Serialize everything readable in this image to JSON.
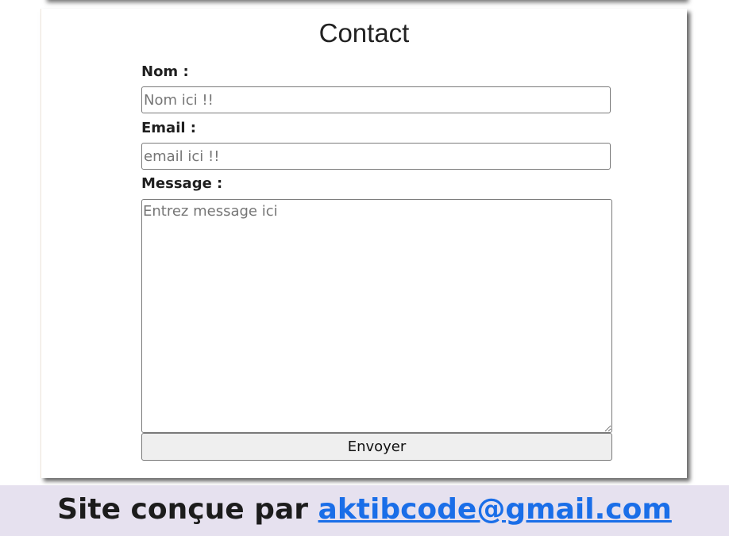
{
  "contact": {
    "title": "Contact",
    "name_label": "Nom :",
    "name_placeholder": "Nom ici !!",
    "email_label": "Email :",
    "email_placeholder": "email ici !!",
    "message_label": "Message :",
    "message_placeholder": "Entrez message ici",
    "submit_label": "Envoyer"
  },
  "footer": {
    "text": "Site conçue par",
    "email_link": "aktibcode@gmail.com"
  },
  "colors": {
    "footer_background": "#e6e1ef",
    "link": "#1a6ee8",
    "button_background": "#efefef"
  }
}
